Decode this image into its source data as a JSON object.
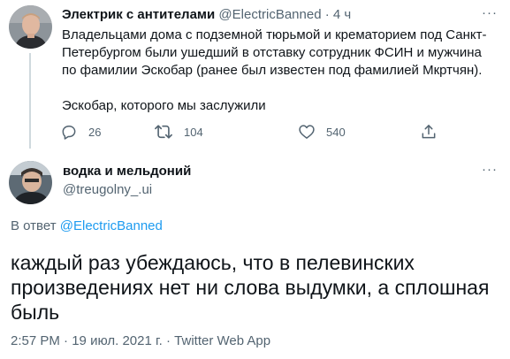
{
  "parent_tweet": {
    "author_name": "Электрик с антителами",
    "author_handle": "@ElectricBanned",
    "separator": "·",
    "time_ago": "4 ч",
    "more_label": "···",
    "text_paragraph_1": "Владельцами дома с подземной тюрьмой и крематорием под Санкт-Петербургом были ушедший в отставку сотрудник ФСИН и мужчина по фамилии Эскобар (ранее был известен под фамилией Мкртчян).",
    "text_paragraph_2": "Эскобар, которого мы заслужили",
    "replies": "26",
    "retweets": "104",
    "likes": "540",
    "icons": {
      "reply": "reply-icon",
      "retweet": "retweet-icon",
      "like": "heart-icon",
      "share": "share-icon"
    }
  },
  "reply_tweet": {
    "author_name": "водка и мельдоний",
    "author_handle": "@treugolny_.ui",
    "more_label": "···",
    "reply_prefix": "В ответ",
    "reply_to": "@ElectricBanned",
    "text": "каждый раз убеждаюсь, что в пелевинских произведениях нет ни слова выдумки, а сплошная быль",
    "time": "2:57 PM",
    "separator": "·",
    "date": "19 июл. 2021 г.",
    "app": "Twitter Web App"
  },
  "colors": {
    "text": "#0f1419",
    "secondary": "#536471",
    "link": "#1d9bf0",
    "thread_line": "#cfd9de"
  }
}
